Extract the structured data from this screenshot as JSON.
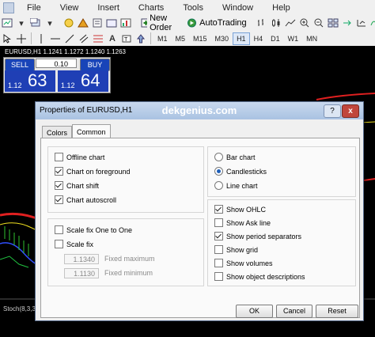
{
  "menu": [
    "File",
    "View",
    "Insert",
    "Charts",
    "Tools",
    "Window",
    "Help"
  ],
  "toolbar": {
    "new_order": "New Order",
    "autotrading": "AutoTrading"
  },
  "timeframes": [
    "M1",
    "M5",
    "M15",
    "M30",
    "H1",
    "H4",
    "D1",
    "W1",
    "MN"
  ],
  "active_timeframe": "H1",
  "chart": {
    "title": "EURUSD,H1  1.1241 1.1272 1.1240 1.1263",
    "sell_label": "SELL",
    "buy_label": "BUY",
    "lot": "0.10",
    "sell_small": "1.12",
    "sell_big": "63",
    "buy_small": "1.12",
    "buy_big": "64",
    "indicator": "Stoch(8,3,3)"
  },
  "dialog": {
    "title": "Properties of EURUSD,H1",
    "brand": "dekgenius.com",
    "help": "?",
    "close": "x",
    "tabs": [
      "Colors",
      "Common"
    ],
    "selected_tab": "Common",
    "left_top": [
      {
        "label": "Offline chart",
        "checked": false
      },
      {
        "label": "Chart on foreground",
        "checked": true
      },
      {
        "label": "Chart shift",
        "checked": true
      },
      {
        "label": "Chart autoscroll",
        "checked": true
      }
    ],
    "left_bottom": [
      {
        "label": "Scale fix One to One",
        "checked": false
      },
      {
        "label": "Scale fix",
        "checked": false
      }
    ],
    "fixed_max": {
      "value": "1.1340",
      "label": "Fixed maximum"
    },
    "fixed_min": {
      "value": "1.1130",
      "label": "Fixed minimum"
    },
    "chart_types": [
      {
        "label": "Bar chart",
        "selected": false
      },
      {
        "label": "Candlesticks",
        "selected": true
      },
      {
        "label": "Line chart",
        "selected": false
      }
    ],
    "show_options": [
      {
        "label": "Show OHLC",
        "checked": true
      },
      {
        "label": "Show Ask line",
        "checked": false
      },
      {
        "label": "Show period separators",
        "checked": true
      },
      {
        "label": "Show grid",
        "checked": false
      },
      {
        "label": "Show volumes",
        "checked": false
      },
      {
        "label": "Show object descriptions",
        "checked": false
      }
    ],
    "buttons": {
      "ok": "OK",
      "cancel": "Cancel",
      "reset": "Reset"
    }
  },
  "colors": {
    "buy_blue": "#1f3fb5",
    "accent": "#1f5fb8",
    "close_red": "#c0463c"
  }
}
